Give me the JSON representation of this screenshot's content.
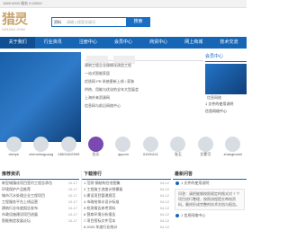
{
  "topbar": {
    "left": "1569.0000 服务 0.00000",
    "right": ""
  },
  "logo": {
    "main": "猎灵",
    "sub": "LIELING.COM"
  },
  "search": {
    "select": "资料",
    "placeholder": "请输入搜索关键词",
    "button": "搜索"
  },
  "nav": [
    "关于我们",
    "行业资讯",
    "注册中心",
    "会员中心",
    "商贸中心",
    "网上商城",
    "技术交流"
  ],
  "col2": {
    "rows": [
      "建筑工程企业规模化改造工程",
      "一站式智能家居",
      "优质网 PR 系统更新上线 / 家装",
      "供热、用能与优化的全年大型展会",
      "上海外来资源网",
      "信息网与前沿网络中心"
    ]
  },
  "col3": {
    "header": "会员中心",
    "banner_text": "信息网络",
    "links": [
      "1 文件的使用说明",
      "信息网络中心"
    ]
  },
  "avatars": [
    "xiehye",
    "chennlimguang",
    "13801602999",
    "优乐",
    "qqcom",
    "01591111",
    "张玉",
    "艾蒙可",
    "zhangboshi"
  ],
  "b1": {
    "title": "推荐资讯",
    "items": [
      [
        "新型城镇化项目签约工程总承包",
        "10-17"
      ],
      [
        "环境保护产品推荐",
        "10-17"
      ],
      [
        "城市污水处理企业工程项目",
        "10-17"
      ],
      [
        "工程服务平台上线运营",
        "10-17"
      ],
      [
        "建筑行业年度报告发布",
        "10-17"
      ],
      [
        "市政设施建设项目进展",
        "10-17"
      ],
      [
        "智能制造发展论坛",
        "10-17"
      ]
    ]
  },
  "b2": {
    "title": "下载排行",
    "items": [
      [
        "1 范例 钢结构住宅图集",
        "04-12"
      ],
      [
        "2 工程施工进度计划模板",
        "04-12"
      ],
      [
        "3 建设项目管理规范",
        "04-12"
      ],
      [
        "4 市政给排水设计标准",
        "04-12"
      ],
      [
        "5 检测报告参考资料",
        "04-12"
      ],
      [
        "6 营商环境分析报告",
        "04-12"
      ],
      [
        "7 项目招标文件范本",
        "04-12"
      ],
      [
        "8 2020 年度行业统计",
        "04-12"
      ]
    ]
  },
  "b3": {
    "title": "最新问答",
    "q": "1 文件的使用说明",
    "answer": "问答：请把能够按照规定的格式对 7 个项目进行整理，按照流程提交审核资料，最终形成完整的技术文档与报告。",
    "q2": "1 信息网络中心"
  },
  "colors": {
    "primary": "#1766b6",
    "accent": "#c8a46a"
  }
}
